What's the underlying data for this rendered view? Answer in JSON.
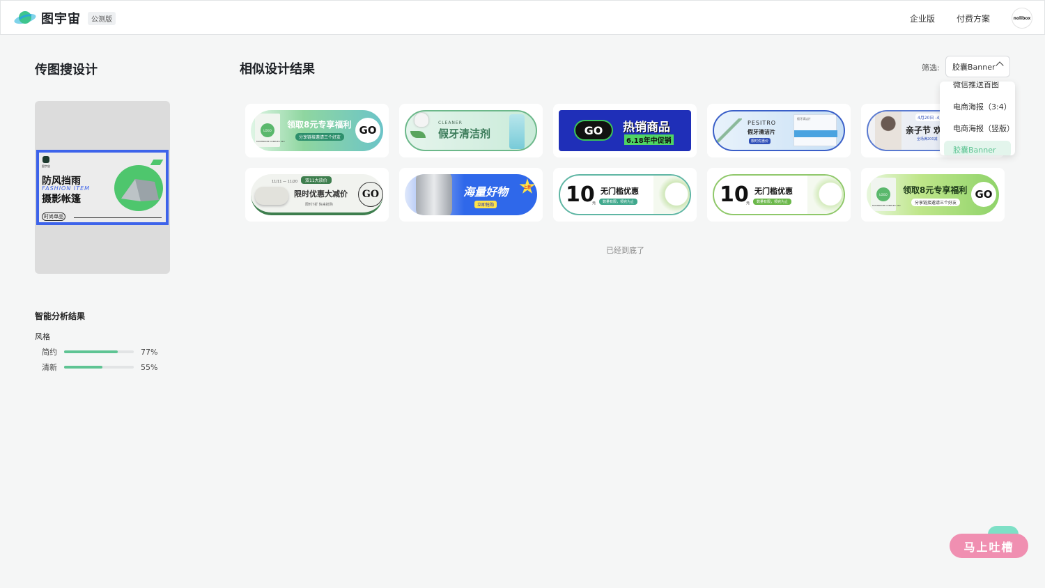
{
  "header": {
    "logo_text": "图宇宙",
    "beta_badge": "公测版",
    "nav": [
      "企业版",
      "付费方案"
    ],
    "avatar_text": "nolibox"
  },
  "left": {
    "title": "传图搜设计",
    "uploaded_image": {
      "title_line1": "防风挡雨",
      "en_line": "FASHION ITEM",
      "title_line2": "摄影帐篷",
      "footer": "时尚单品",
      "logo_text": "图宇宙"
    },
    "analysis_title": "智能分析结果",
    "style_label": "风格",
    "styles": [
      {
        "name": "简约",
        "percent": 77,
        "label": "77%"
      },
      {
        "name": "清新",
        "percent": 55,
        "label": "55%"
      }
    ]
  },
  "main": {
    "title": "相似设计结果",
    "filter_label": "筛选:",
    "filter_value": "胶囊Banner",
    "end_text": "已经到底了",
    "cards": [
      {
        "title": "领取8元专享福利",
        "sub": "分享链接邀请三个好友",
        "go": "GO",
        "logo": "LOGO",
        "product": "MUSHROOM COMPLEX X10"
      },
      {
        "title": "假牙清洁剂",
        "brand": "CLEANER"
      },
      {
        "go": "GO",
        "title": "热销商品",
        "sub": "6.18年中促销"
      },
      {
        "brand": "PESITRO",
        "title": "假牙清洁片",
        "tag": "限时优惠价",
        "box_label": "假牙清洁片"
      },
      {
        "date": "4月20日 -4月",
        "title": "亲子节 欢",
        "sub": "全场满200减"
      },
      {
        "tag": "双11大放价",
        "date": "11/11 — 11/20",
        "title": "限时优惠大减价",
        "sub": "限时7折 快来抢购",
        "go": "GO"
      },
      {
        "title": "海量好物",
        "sub": "立即抢购",
        "badge": "上新"
      },
      {
        "number": "10",
        "unit": "元",
        "title": "无门槛优惠",
        "sub": "数量有限，领完为止"
      },
      {
        "number": "10",
        "unit": "元",
        "title": "无门槛优惠",
        "sub": "数量有限，领完为止"
      },
      {
        "title": "领取8元专享福利",
        "sub": "分享链接邀请三个好友",
        "go": "GO",
        "logo": "LOGO",
        "product": "MUSHROOM COMPLEX X10"
      }
    ]
  },
  "dropdown": {
    "items": [
      "微信推送首图",
      "电商海报（3:4）",
      "电商海报（竖版）",
      "胶囊Banner"
    ],
    "selected": "胶囊Banner"
  },
  "feedback": {
    "label": "马上吐槽"
  },
  "colors": {
    "accent": "#5ec493",
    "selection_border": "#3d63ea",
    "feedback": "#f08fb1"
  }
}
